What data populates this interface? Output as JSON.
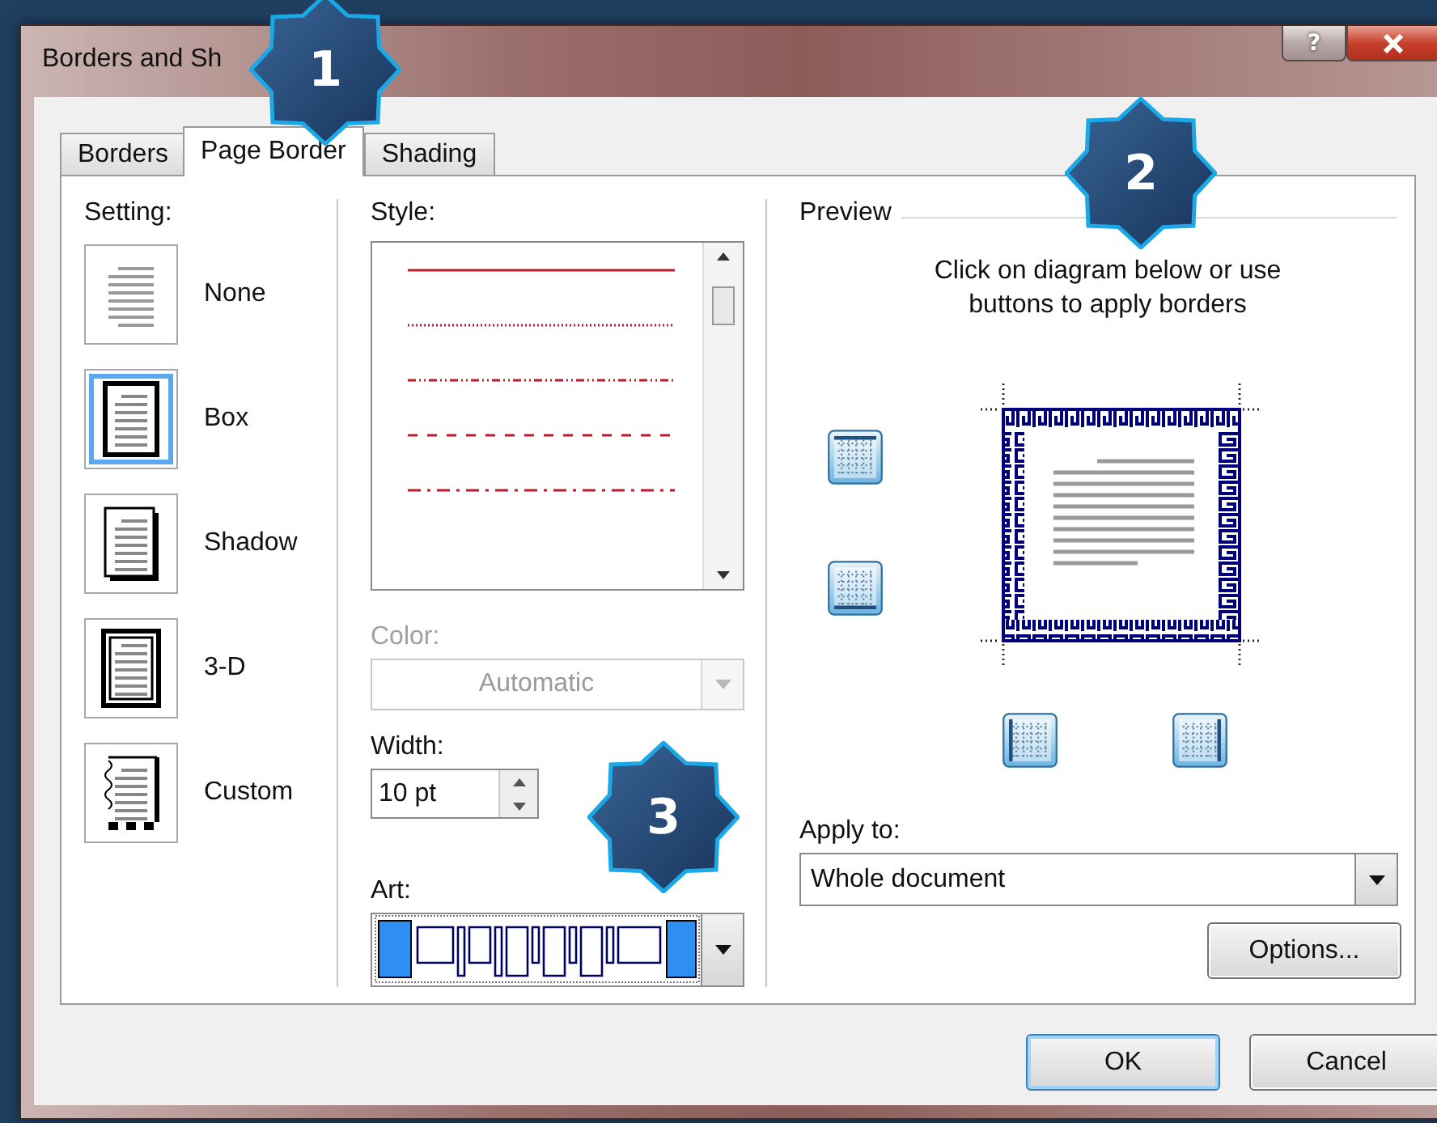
{
  "window": {
    "title": "Borders and Sh",
    "help": "?"
  },
  "tabs": [
    {
      "label": "Borders",
      "selected": false
    },
    {
      "label": "Page Border",
      "selected": true
    },
    {
      "label": "Shading",
      "selected": false
    }
  ],
  "setting": {
    "label": "Setting:",
    "items": [
      {
        "label": "None",
        "kind": "none",
        "selected": false
      },
      {
        "label": "Box",
        "kind": "box",
        "selected": true
      },
      {
        "label": "Shadow",
        "kind": "shadow",
        "selected": false
      },
      {
        "label": "3-D",
        "kind": "three-d",
        "selected": false
      },
      {
        "label": "Custom",
        "kind": "custom",
        "selected": false
      }
    ]
  },
  "style": {
    "label": "Style:",
    "lines": [
      {
        "kind": "solid"
      },
      {
        "kind": "dotted"
      },
      {
        "kind": "dash-dot-dot"
      },
      {
        "kind": "dashed"
      },
      {
        "kind": "dash-dot"
      }
    ]
  },
  "color": {
    "label": "Color:",
    "value": "Automatic",
    "disabled": true
  },
  "width": {
    "label": "Width:",
    "value": "10 pt"
  },
  "art": {
    "label": "Art:"
  },
  "preview": {
    "title": "Preview",
    "hint": "Click on diagram below or use buttons to apply borders",
    "side_buttons": [
      {
        "kind": "top"
      },
      {
        "kind": "bottom"
      },
      {
        "kind": "left"
      },
      {
        "kind": "right"
      }
    ]
  },
  "apply_to": {
    "label": "Apply to:",
    "value": "Whole document"
  },
  "options_button": "Options...",
  "buttons": [
    {
      "label": "OK",
      "default": true
    },
    {
      "label": "Cancel",
      "default": false
    }
  ],
  "badges": [
    {
      "label": "1"
    },
    {
      "label": "2"
    },
    {
      "label": "3"
    }
  ]
}
